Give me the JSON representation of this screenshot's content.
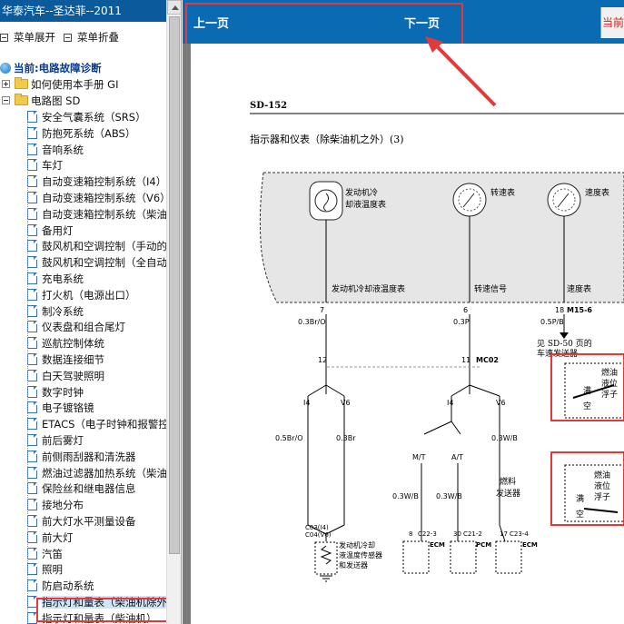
{
  "app": {
    "title": "华泰汽车--圣达菲--2011"
  },
  "toolbar": {
    "expand_label": "菜单展开",
    "collapse_label": "菜单折叠"
  },
  "tree": {
    "current_label": "当前:电路故障诊断",
    "folders": [
      {
        "label": "如何使用本手册 GI",
        "state": "collapsed"
      },
      {
        "label": "电路图 SD",
        "state": "expanded"
      }
    ],
    "items": [
      "安全气囊系统（SRS）",
      "防抱死系统（ABS）",
      "音响系统",
      "车灯",
      "自动变速箱控制系统（I4）",
      "自动变速箱控制系统（V6）",
      "自动变速箱控制系统（柴油",
      "备用灯",
      "鼓风机和空调控制（手动的",
      "鼓风机和空调控制（全自动",
      "充电系统",
      "打火机（电源出口）",
      "制冷系统",
      "仪表盘和组合尾灯",
      "巡航控制体统",
      "数据连接细节",
      "白天驾驶照明",
      "数字时钟",
      "电子镀铬镜",
      "ETACS（电子时钟和报警控",
      "前后雾灯",
      "前侧雨刮器和清洗器",
      "燃油过滤器加热系统（柴油",
      "保险丝和继电器信息",
      "接地分布",
      "前大灯水平测量设备",
      "前大灯",
      "汽笛",
      "照明",
      "防启动系统",
      "指示灯和量表（柴油机除外",
      "指示灯和量表（柴油机）"
    ],
    "selected_index": 30
  },
  "nav": {
    "prev_label": "上一页",
    "next_label": "下一页",
    "current_label": "当前"
  },
  "document": {
    "page_code": "SD-152",
    "page_title": "指示器和仪表（除柴油机之外）(3)",
    "gauges": [
      {
        "label": "发动机冷却液温度表"
      },
      {
        "label": "转速表"
      },
      {
        "label": "速度表"
      }
    ],
    "bus_labels": [
      "发动机冷却液温度表",
      "转速信号",
      "速度表"
    ],
    "pins_top": [
      "7",
      "6",
      "18"
    ],
    "wires_top": [
      "0.3Br/O",
      "0.3P",
      "0.5P/B"
    ],
    "connector_top": "M15-6",
    "connector_mid": "MC02",
    "pins_mid": [
      "12",
      "11"
    ],
    "ref_note": "见 SD-50 页的车速发送器",
    "engine_labels": [
      "I4",
      "V6"
    ],
    "engine_wires": [
      "0.5Br/O",
      "0.3Br"
    ],
    "mt_at": [
      "M/T",
      "A/T"
    ],
    "right_engine_labels": [
      "I4",
      "V6"
    ],
    "right_wire": "0.3W/B",
    "lower_wires": [
      "0.3W/B",
      "0.3W/B"
    ],
    "fuel_sender": "燃料发送器",
    "float_label": "燃油液位浮子",
    "full_empty": [
      "满",
      "空"
    ],
    "sensor_connector": "C03(I4) C04(V6)",
    "sensor_label": "发动机冷却液温度传感器和发送器",
    "bottom_connectors": [
      {
        "pin": "8",
        "code": "C22-3",
        "ecm": "ECM"
      },
      {
        "pin": "30",
        "code": "C21-2",
        "ecm": "PCM"
      },
      {
        "pin": "17",
        "code": "C23-4",
        "ecm": "ECM"
      }
    ]
  },
  "colors": {
    "title_bar": "#0a5a9c",
    "nav_bar": "#0a6bb3",
    "highlight": "#e23a3a"
  }
}
